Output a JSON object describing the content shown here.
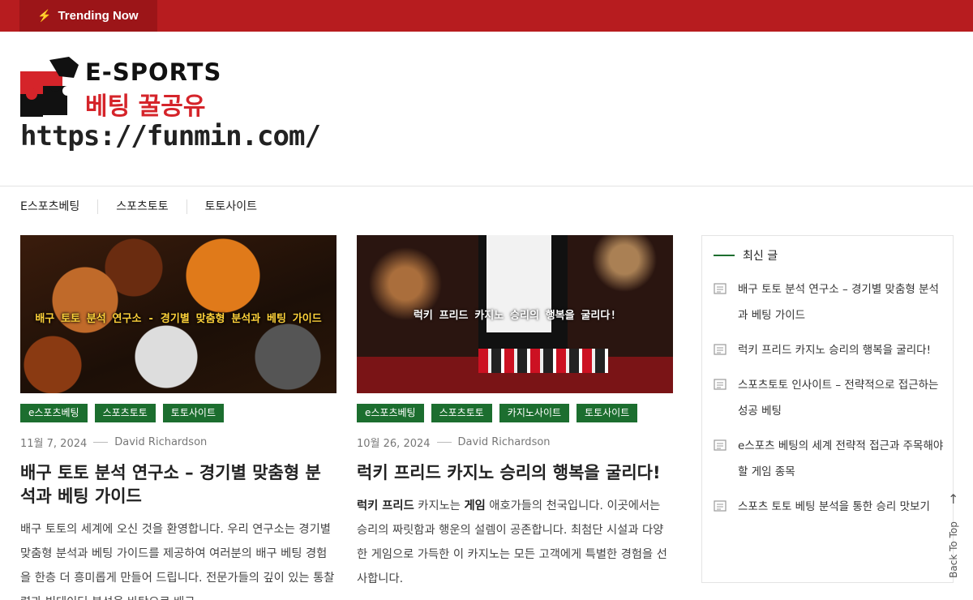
{
  "topbar": {
    "trending_label": "Trending Now"
  },
  "logo": {
    "line1": "E-SPORTS",
    "line2": "베팅 꿀공유",
    "colors": {
      "red": "#d5242a",
      "black": "#111111"
    }
  },
  "site": {
    "url": "https://funmin.com/"
  },
  "nav": [
    "E스포츠베팅",
    "스포츠토토",
    "토토사이트"
  ],
  "posts": [
    {
      "image_caption": "배구 토토 분석 연구소 - 경기별 맞춤형 분석과 베팅 가이드",
      "tags": [
        "e스포츠베팅",
        "스포츠토토",
        "토토사이트"
      ],
      "date": "11월 7, 2024",
      "author": "David Richardson",
      "title": "배구 토토 분석 연구소 – 경기별 맞춤형 분석과 베팅 가이드",
      "excerpt": "배구 토토의 세계에 오신 것을 환영합니다. 우리 연구소는 경기별 맞춤형 분석과 베팅 가이드를 제공하여 여러분의 배구 베팅 경험을 한층 더 흥미롭게 만들어 드립니다. 전문가들의 깊이 있는 통찰력과 빅데이터 분석을 바탕으로 배구"
    },
    {
      "image_caption": "럭키 프리드 카지노 승리의 행복을 굴리다!",
      "tags": [
        "e스포츠베팅",
        "스포츠토토",
        "카지노사이트",
        "토토사이트"
      ],
      "date": "10월 26, 2024",
      "author": "David Richardson",
      "title": "럭키 프리드 카지노 승리의 행복을 굴리다!",
      "excerpt_bold1": "럭키 프리드",
      "excerpt_mid1": " 카지노는 ",
      "excerpt_bold2": "게임",
      "excerpt_rest": " 애호가들의 천국입니다. 이곳에서는 승리의 짜릿함과 행운의 설렘이 공존합니다. 최첨단 시설과 다양한 게임으로 가득한 이 카지노는 모든 고객에게 특별한 경험을 선사합니다."
    }
  ],
  "sidebar": {
    "heading": "최신 글",
    "items": [
      "배구 토토 분석 연구소 – 경기별 맞춤형 분석과 베팅 가이드",
      "럭키 프리드 카지노 승리의 행복을 굴리다!",
      "스포츠토토 인사이트 – 전략적으로 접근하는 성공 베팅",
      "e스포츠 베팅의 세계 전략적 접근과 주목해야 할 게임 종목",
      "스포츠 토토 베팅 분석을 통한 승리 맛보기"
    ]
  },
  "back_to_top": "Back To Top",
  "colors": {
    "topbar": "#b71c1f",
    "tag_bg": "#1c6e2f"
  }
}
